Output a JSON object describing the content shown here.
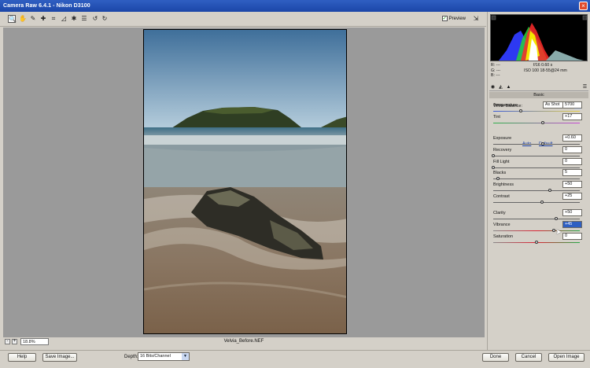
{
  "window": {
    "title": "Camera Raw 6.4.1 - Nikon D3100",
    "close_glyph": "×"
  },
  "toolbar": {
    "tools": [
      {
        "name": "zoom-tool-icon",
        "glyph": "🔍"
      },
      {
        "name": "hand-tool-icon",
        "glyph": "✋"
      },
      {
        "name": "white-balance-tool-icon",
        "glyph": "✎"
      },
      {
        "name": "color-sampler-tool-icon",
        "glyph": "✚"
      },
      {
        "name": "crop-tool-icon",
        "glyph": "⌗"
      },
      {
        "name": "straighten-tool-icon",
        "glyph": "◿"
      },
      {
        "name": "spot-removal-tool-icon",
        "glyph": "✱"
      },
      {
        "name": "preferences-icon",
        "glyph": "☰"
      },
      {
        "name": "rotate-left-icon",
        "glyph": "↺"
      },
      {
        "name": "rotate-right-icon",
        "glyph": "↻"
      }
    ],
    "preview_label": "Preview",
    "preview_checked": "✓",
    "fullscreen_glyph": "⇲"
  },
  "canvas": {
    "zoom_minus": "-",
    "zoom_plus": "+",
    "zoom_value": "18.8%",
    "filename": "Velvia_Before.NEF"
  },
  "footer": {
    "help_label": "Help",
    "save_label": "Save Image...",
    "depth_label": "Depth:",
    "depth_value": "16 Bits/Channel",
    "done_label": "Done",
    "cancel_label": "Cancel",
    "open_label": "Open Image"
  },
  "readout": {
    "r": "R:  ---",
    "g": "G:  ---",
    "b": "B:  ---",
    "aperture_shutter": "f/16   0.60 s",
    "iso_lens": "ISO 100   18-55@24 mm"
  },
  "panel": {
    "section_title": "Basic",
    "white_balance_label": "White Balance:",
    "white_balance_value": "As Shot",
    "auto_label": "Auto",
    "default_label": "Default",
    "sliders": [
      {
        "key": "temperature",
        "label": "Temperature",
        "value": "5700",
        "position": 0.32
      },
      {
        "key": "tint",
        "label": "Tint",
        "value": "+17",
        "position": 0.57
      },
      {
        "key": "exposure",
        "label": "Exposure",
        "value": "+0.60",
        "position": 0.57
      },
      {
        "key": "recovery",
        "label": "Recovery",
        "value": "0",
        "position": 0.0
      },
      {
        "key": "fill-light",
        "label": "Fill Light",
        "value": "0",
        "position": 0.0
      },
      {
        "key": "blacks",
        "label": "Blacks",
        "value": "5",
        "position": 0.05
      },
      {
        "key": "brightness",
        "label": "Brightness",
        "value": "+50",
        "position": 0.65
      },
      {
        "key": "contrast",
        "label": "Contrast",
        "value": "+25",
        "position": 0.56
      },
      {
        "key": "clarity",
        "label": "Clarity",
        "value": "+50",
        "position": 0.73
      },
      {
        "key": "vibrance",
        "label": "Vibrance",
        "value": "+45",
        "position": 0.7
      },
      {
        "key": "saturation",
        "label": "Saturation",
        "value": "0",
        "position": 0.5
      }
    ]
  },
  "colors": {
    "titlebar": "#1b46a8",
    "panel": "#d4d0c8",
    "canvas": "#9a9a9a",
    "selection": "#2f5fc2"
  }
}
